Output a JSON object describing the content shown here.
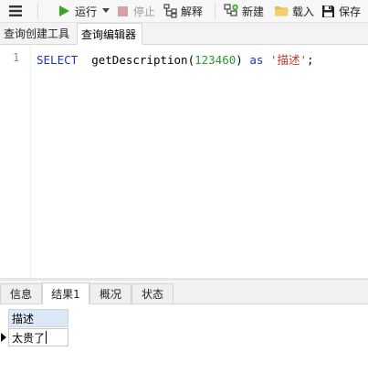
{
  "toolbar": {
    "run_label": "运行",
    "stop_label": "停止",
    "explain_label": "解释",
    "new_label": "新建",
    "load_label": "载入",
    "save_label": "保存"
  },
  "editor_tabs": [
    {
      "label": "查询创建工具"
    },
    {
      "label": "查询编辑器"
    }
  ],
  "editor": {
    "line_number": "1",
    "code": {
      "keyword_select": "SELECT",
      "function_call": "getDescription(",
      "number": "123460",
      "close_paren": ")",
      "keyword_as": "as",
      "string": "'描述'",
      "terminator": ";"
    }
  },
  "result_tabs": [
    {
      "label": "信息"
    },
    {
      "label": "结果1"
    },
    {
      "label": "概况"
    },
    {
      "label": "状态"
    }
  ],
  "result_grid": {
    "column_header": "描述",
    "rows": [
      {
        "value": "太贵了"
      }
    ]
  },
  "colors": {
    "keyword": "#1b33c7",
    "number": "#2b9a2b",
    "string": "#c23a2a",
    "run_icon": "#3aa629",
    "grid_header": "#dbe8f5"
  }
}
